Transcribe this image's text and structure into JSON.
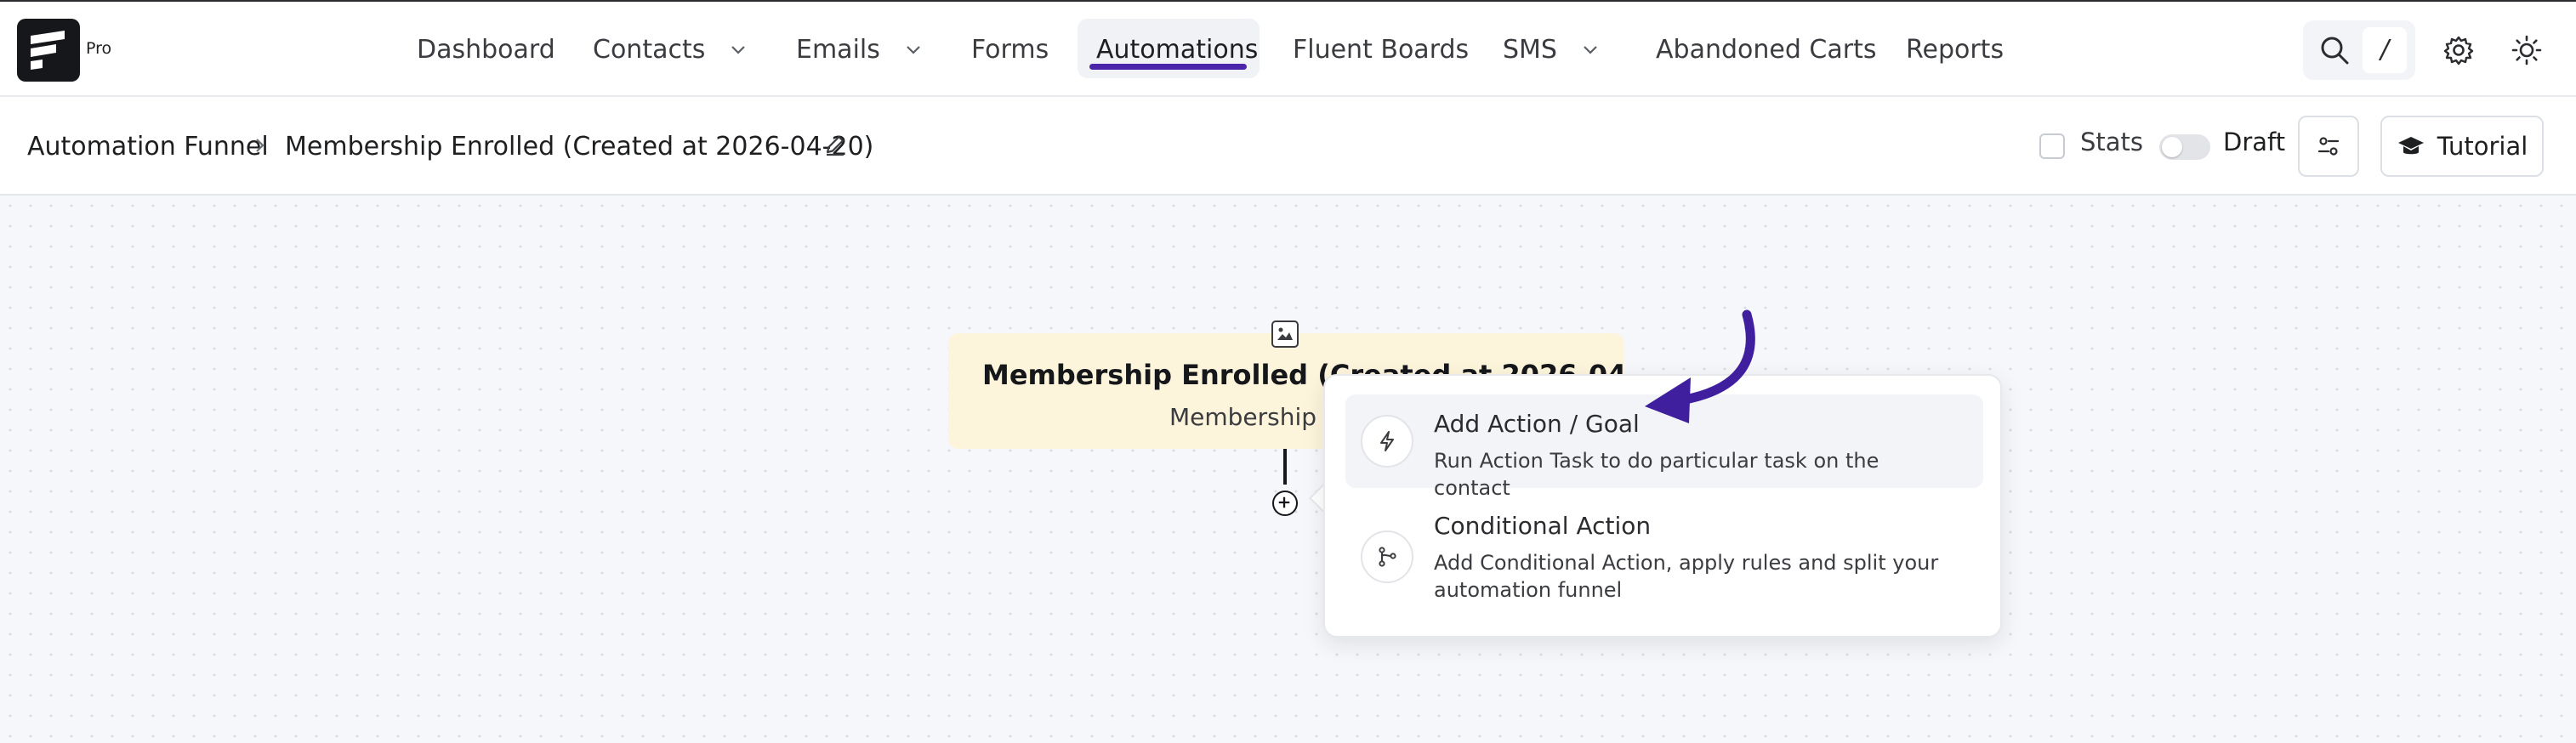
{
  "app": {
    "badge": "Pro"
  },
  "nav": {
    "items": [
      {
        "label": "Dashboard"
      },
      {
        "label": "Contacts"
      },
      {
        "label": "Emails"
      },
      {
        "label": "Forms"
      },
      {
        "label": "Automations"
      },
      {
        "label": "Fluent Boards"
      },
      {
        "label": "SMS"
      },
      {
        "label": "Abandoned Carts"
      },
      {
        "label": "Reports"
      }
    ],
    "active": "Automations",
    "search_shortcut": "/"
  },
  "breadcrumb": {
    "root": "Automation Funnel",
    "current": "Membership Enrolled (Created at 2026-04-20)"
  },
  "toolbar": {
    "stats_label": "Stats",
    "stats_checked": false,
    "draft_label": "Draft",
    "draft_enabled": false,
    "tutorial_label": "Tutorial"
  },
  "trigger": {
    "title": "Membership Enrolled (Created at 2026-04-20)",
    "subtitle": "Membership Enrolled"
  },
  "menu": {
    "items": [
      {
        "title": "Add Action / Goal",
        "description": "Run Action Task to do particular task on the contact"
      },
      {
        "title": "Conditional Action",
        "description": "Add Conditional Action, apply rules and split your automation funnel"
      }
    ]
  },
  "colors": {
    "accent": "#4a25aa",
    "trigger_card": "#fdf4dc",
    "canvas": "#f6f7fa"
  }
}
